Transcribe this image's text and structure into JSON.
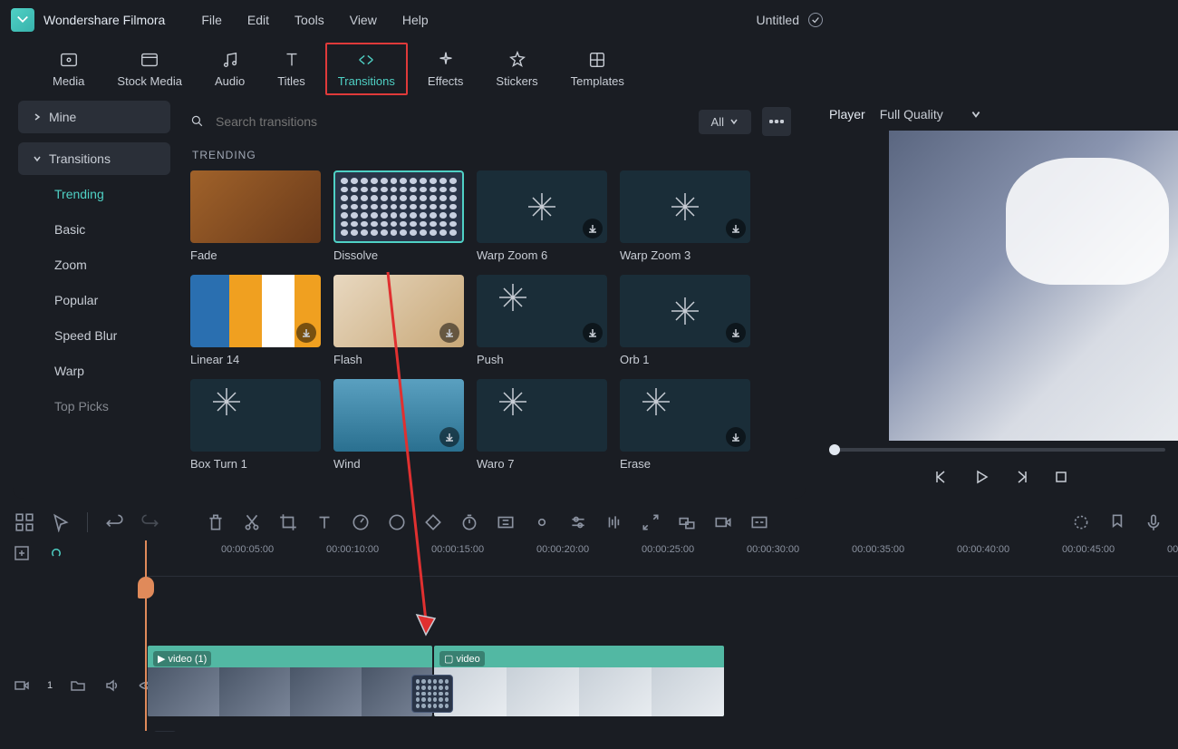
{
  "app": {
    "name": "Wondershare Filmora",
    "document": "Untitled"
  },
  "menu": [
    "File",
    "Edit",
    "Tools",
    "View",
    "Help"
  ],
  "topTabs": [
    {
      "label": "Media",
      "icon": "media"
    },
    {
      "label": "Stock Media",
      "icon": "stock"
    },
    {
      "label": "Audio",
      "icon": "audio"
    },
    {
      "label": "Titles",
      "icon": "titles"
    },
    {
      "label": "Transitions",
      "icon": "transitions",
      "active": true
    },
    {
      "label": "Effects",
      "icon": "effects"
    },
    {
      "label": "Stickers",
      "icon": "stickers"
    },
    {
      "label": "Templates",
      "icon": "templates"
    }
  ],
  "sidebar": {
    "mine": "Mine",
    "category": "Transitions",
    "items": [
      "Trending",
      "Basic",
      "Zoom",
      "Popular",
      "Speed Blur",
      "Warp",
      "Top Picks"
    ],
    "selected": "Trending"
  },
  "search": {
    "placeholder": "Search transitions",
    "filter": "All"
  },
  "section": {
    "heading": "TRENDING"
  },
  "transitions": [
    {
      "name": "Fade",
      "style": "th-fade"
    },
    {
      "name": "Dissolve",
      "style": "th-dissolve",
      "selected": true
    },
    {
      "name": "Warp Zoom 6",
      "style": "th-warp",
      "download": true
    },
    {
      "name": "Warp Zoom 3",
      "style": "th-warp",
      "download": true
    },
    {
      "name": "Linear 14",
      "style": "th-linear",
      "download": true
    },
    {
      "name": "Flash",
      "style": "th-flash",
      "download": true
    },
    {
      "name": "Push",
      "style": "th-push",
      "download": true
    },
    {
      "name": "Orb 1",
      "style": "th-orb",
      "download": true
    },
    {
      "name": "Box Turn 1",
      "style": "th-boxturn"
    },
    {
      "name": "Wind",
      "style": "th-wind",
      "download": true
    },
    {
      "name": "Waro 7",
      "style": "th-waro7"
    },
    {
      "name": "Erase",
      "style": "th-erase",
      "download": true
    }
  ],
  "preview": {
    "tab": "Player",
    "quality": "Full Quality"
  },
  "timeline": {
    "ticks": [
      "00:00:05:00",
      "00:00:10:00",
      "00:00:15:00",
      "00:00:20:00",
      "00:00:25:00",
      "00:00:30:00",
      "00:00:35:00",
      "00:00:40:00",
      "00:00:45:00",
      "00"
    ],
    "clip1": "video (1)",
    "clip2": "video",
    "trackNum": "1"
  }
}
